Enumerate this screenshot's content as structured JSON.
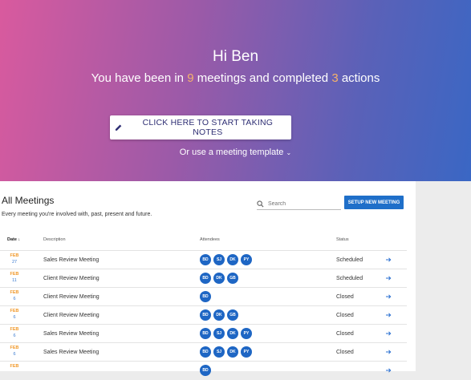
{
  "hero": {
    "greeting": "Hi Ben",
    "stats_pre": "You have been in ",
    "meetings_count": "9",
    "stats_mid": " meetings and completed ",
    "actions_count": "3",
    "stats_post": " actions",
    "cta_label": "CLICK HERE TO START TAKING NOTES",
    "template_link": "Or use a meeting template"
  },
  "panel": {
    "title": "All Meetings",
    "subtitle": "Every meeting you're involved with, past, present and future.",
    "search_placeholder": "Search",
    "setup_button": "SETUP NEW MEETING",
    "columns": {
      "date": "Date",
      "description": "Description",
      "attendees": "Attendees",
      "status": "Status"
    }
  },
  "meetings": [
    {
      "month": "FEB",
      "day": "27",
      "description": "Sales Review Meeting",
      "attendees": [
        "BD",
        "SJ",
        "DK",
        "PY"
      ],
      "status": "Scheduled"
    },
    {
      "month": "FEB",
      "day": "11",
      "description": "Client Review Meeting",
      "attendees": [
        "BD",
        "DK",
        "GB"
      ],
      "status": "Scheduled"
    },
    {
      "month": "FEB",
      "day": "6",
      "description": "Client Review Meeting",
      "attendees": [
        "BD"
      ],
      "status": "Closed"
    },
    {
      "month": "FEB",
      "day": "6",
      "description": "Client Review Meeting",
      "attendees": [
        "BD",
        "DK",
        "GB"
      ],
      "status": "Closed"
    },
    {
      "month": "FEB",
      "day": "6",
      "description": "Sales Review Meeting",
      "attendees": [
        "BD",
        "SJ",
        "DK",
        "PY"
      ],
      "status": "Closed"
    },
    {
      "month": "FEB",
      "day": "6",
      "description": "Sales Review Meeting",
      "attendees": [
        "BD",
        "SJ",
        "DK",
        "PY"
      ],
      "status": "Closed"
    },
    {
      "month": "FEB",
      "day": "",
      "description": "",
      "attendees": [
        "BD"
      ],
      "status": ""
    }
  ],
  "colors": {
    "accent": "#1f6fc9",
    "highlight": "#f5b26b",
    "date_month": "#f19a2c"
  }
}
